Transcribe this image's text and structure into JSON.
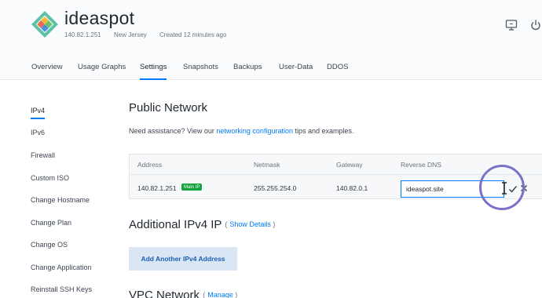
{
  "server": {
    "name": "ideaspot",
    "ip": "140.82.1.251",
    "location": "New Jersey",
    "created": "Created 12 minutes ago"
  },
  "tabs": [
    {
      "label": "Overview"
    },
    {
      "label": "Usage Graphs"
    },
    {
      "label": "Settings"
    },
    {
      "label": "Snapshots"
    },
    {
      "label": "Backups"
    },
    {
      "label": "User-Data"
    },
    {
      "label": "DDOS"
    }
  ],
  "sidebar": {
    "items": [
      {
        "label": "IPv4"
      },
      {
        "label": "IPv6"
      },
      {
        "label": "Firewall"
      },
      {
        "label": "Custom ISO"
      },
      {
        "label": "Change Hostname"
      },
      {
        "label": "Change Plan"
      },
      {
        "label": "Change OS"
      },
      {
        "label": "Change Application"
      },
      {
        "label": "Reinstall SSH Keys"
      }
    ]
  },
  "public_network": {
    "title": "Public Network",
    "assist_prefix": "Need assistance? View our ",
    "assist_link": "networking configuration",
    "assist_suffix": " tips and examples.",
    "columns": [
      "Address",
      "Netmask",
      "Gateway",
      "Reverse DNS"
    ],
    "row": {
      "address": "140.82.1.251",
      "badge": "Main IP",
      "netmask": "255.255.254.0",
      "gateway": "140.82.0.1",
      "reverse_dns": "ideaspot.site"
    }
  },
  "additional_ipv4": {
    "title": "Additional IPv4 IP",
    "show_details": "Show Details",
    "add_button": "Add Another IPv4 Address"
  },
  "vpc": {
    "title": "VPC Network",
    "manage": "Manage"
  },
  "colors": {
    "accent": "#007bfc",
    "badge": "#15a13c",
    "highlight": "#7b72c8"
  },
  "icons": {
    "logo": "ideaspot-logo-icon",
    "monitor": "monitor-icon",
    "power": "power-icon",
    "save": "checkmark-icon",
    "cancel": "close-icon"
  }
}
